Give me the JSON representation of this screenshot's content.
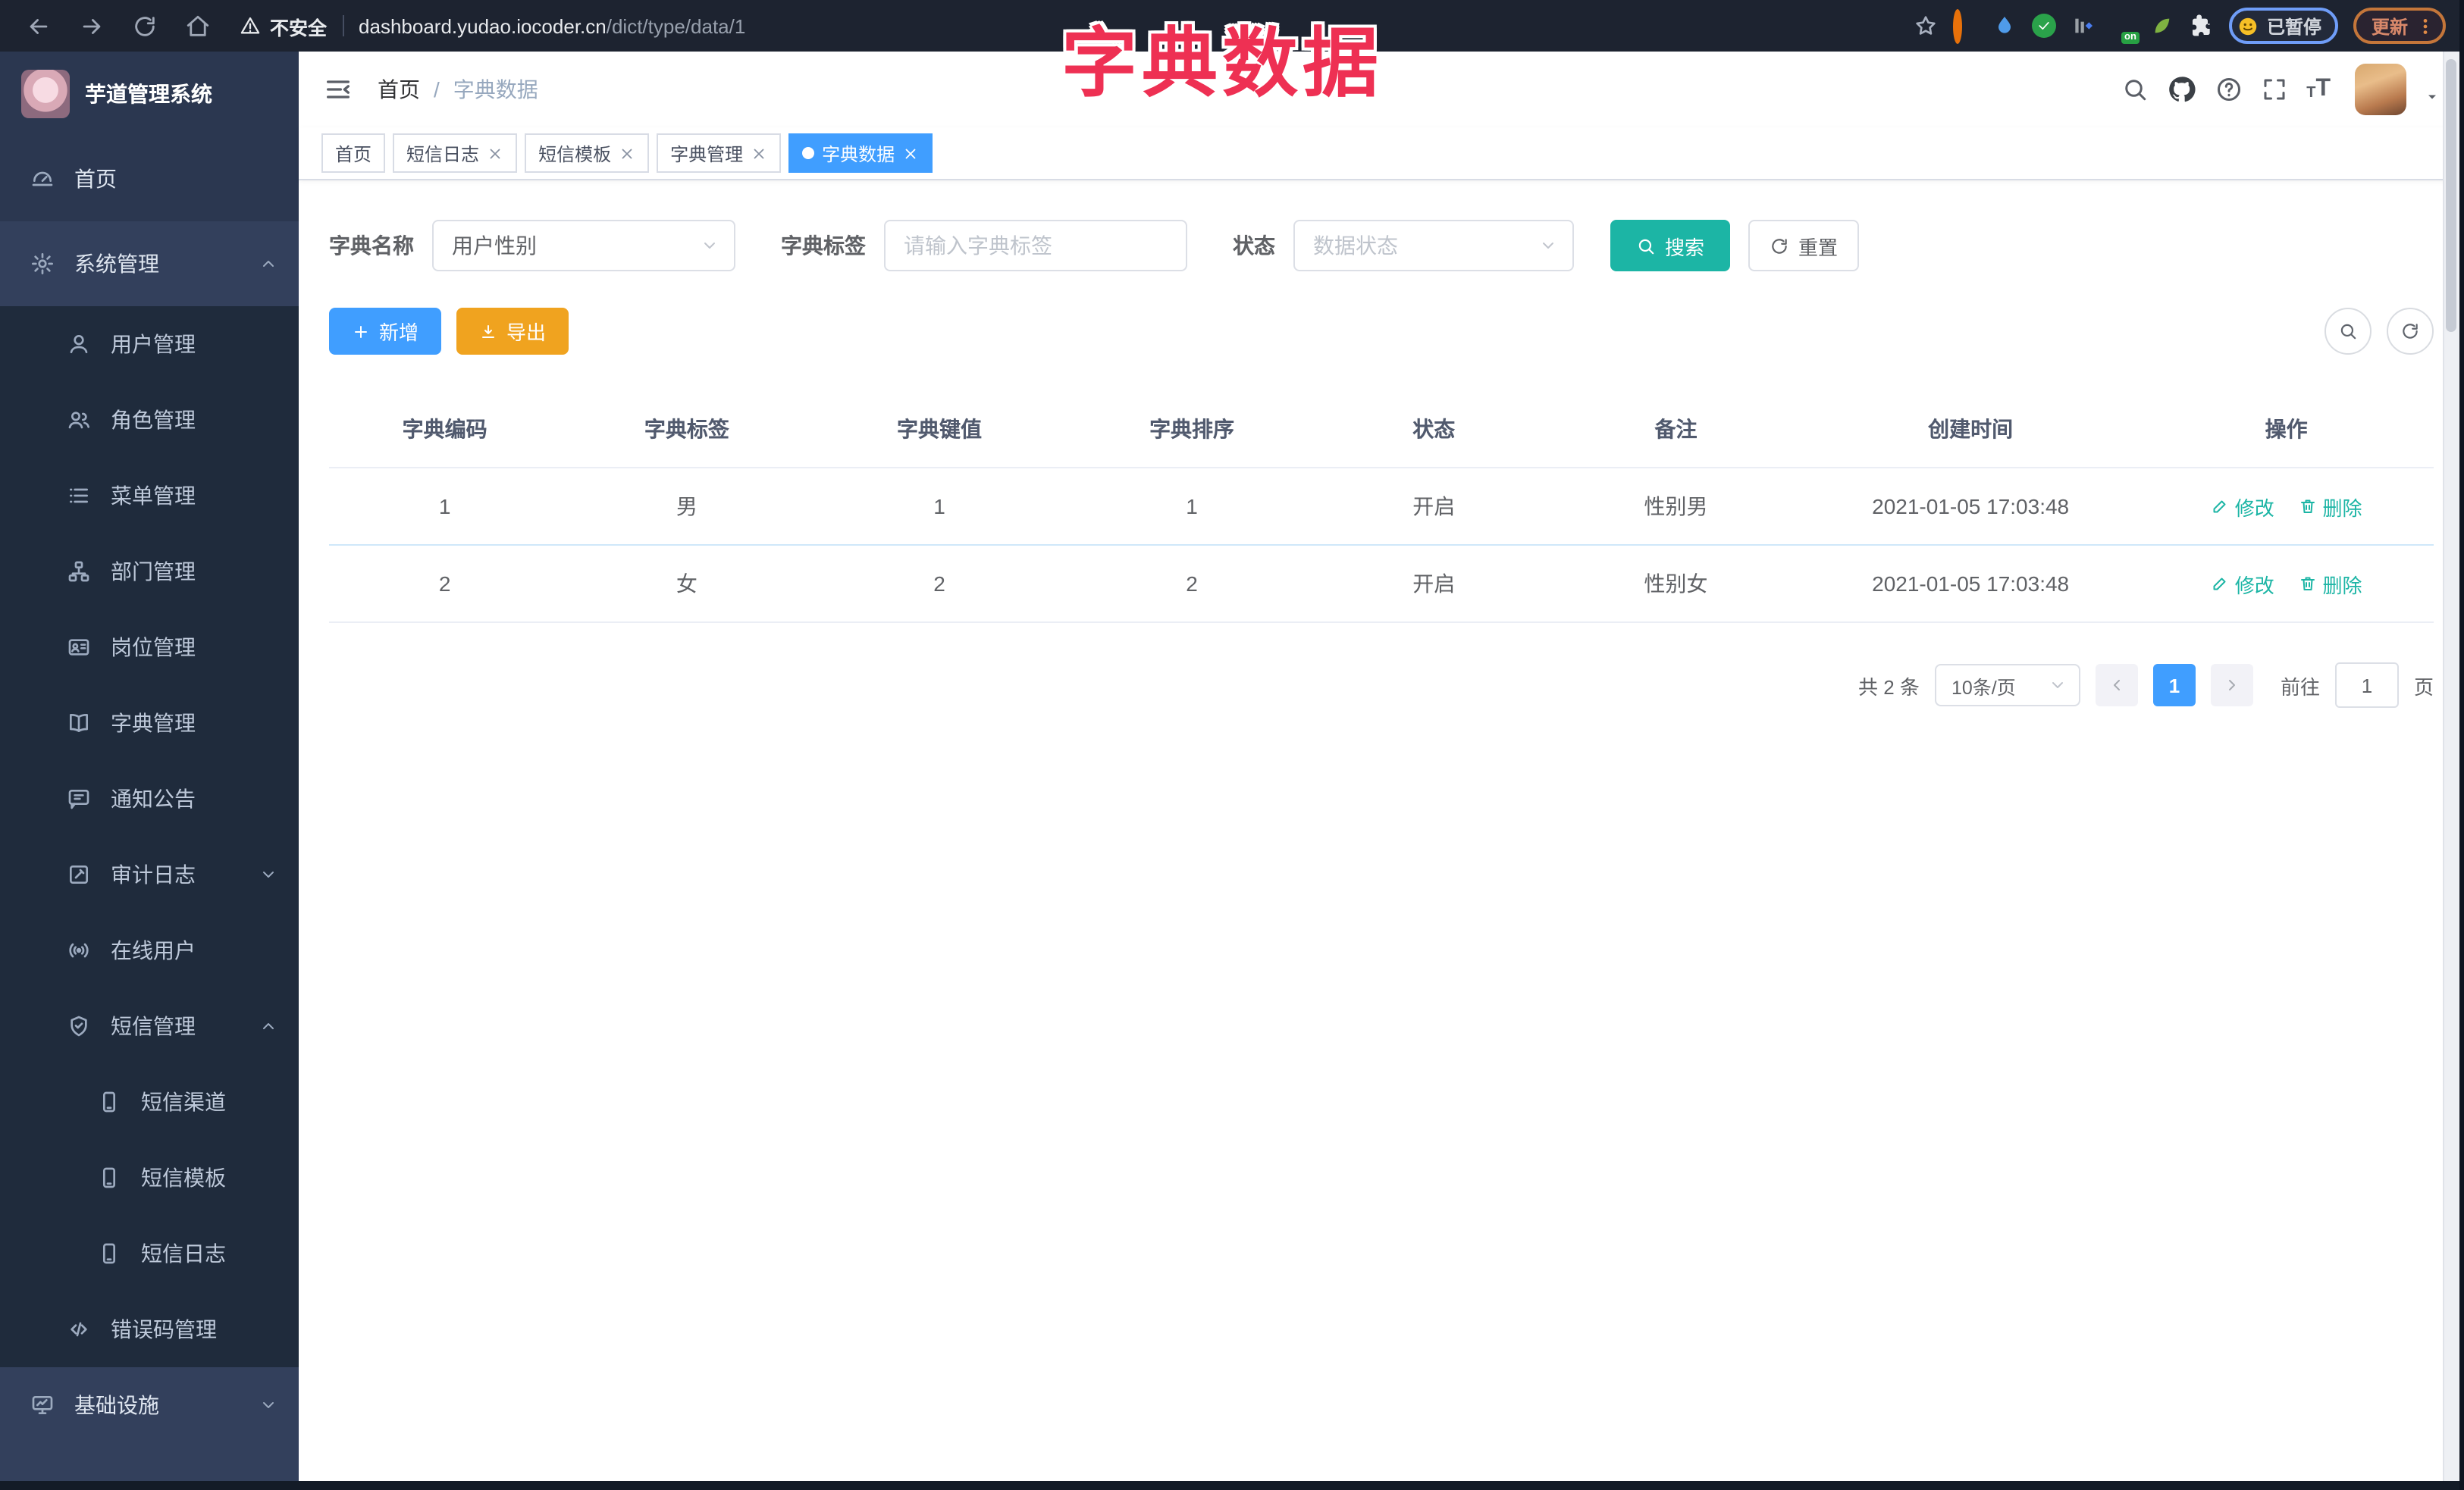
{
  "browser": {
    "security_label": "不安全",
    "url_host": "dashboard.yudao.iocoder.cn",
    "url_path": "/dict/type/data/1",
    "ext_on_badge": "on",
    "paused_label": "已暂停",
    "update_label": "更新"
  },
  "annotation": {
    "text": "字典数据",
    "color": "#ee3053"
  },
  "sidebar": {
    "logo_title": "芋道管理系统",
    "items": [
      {
        "label": "首页"
      },
      {
        "label": "系统管理"
      },
      {
        "label": "用户管理"
      },
      {
        "label": "角色管理"
      },
      {
        "label": "菜单管理"
      },
      {
        "label": "部门管理"
      },
      {
        "label": "岗位管理"
      },
      {
        "label": "字典管理"
      },
      {
        "label": "通知公告"
      },
      {
        "label": "审计日志"
      },
      {
        "label": "在线用户"
      },
      {
        "label": "短信管理"
      },
      {
        "label": "短信渠道"
      },
      {
        "label": "短信模板"
      },
      {
        "label": "短信日志"
      },
      {
        "label": "错误码管理"
      },
      {
        "label": "基础设施"
      }
    ]
  },
  "navbar": {
    "breadcrumb_home": "首页",
    "breadcrumb_sep": "/",
    "breadcrumb_current": "字典数据"
  },
  "tabs": {
    "items": [
      {
        "label": "首页"
      },
      {
        "label": "短信日志"
      },
      {
        "label": "短信模板"
      },
      {
        "label": "字典管理"
      },
      {
        "label": "字典数据"
      }
    ]
  },
  "filters": {
    "name_label": "字典名称",
    "name_value": "用户性别",
    "tag_label": "字典标签",
    "tag_placeholder": "请输入字典标签",
    "status_label": "状态",
    "status_placeholder": "数据状态",
    "search_label": "搜索",
    "reset_label": "重置"
  },
  "actions": {
    "add_label": "新增",
    "export_label": "导出"
  },
  "table": {
    "headers": [
      "字典编码",
      "字典标签",
      "字典键值",
      "字典排序",
      "状态",
      "备注",
      "创建时间",
      "操作"
    ],
    "rows": [
      {
        "code": "1",
        "label": "男",
        "value": "1",
        "sort": "1",
        "status": "开启",
        "remark": "性别男",
        "created": "2021-01-05 17:03:48"
      },
      {
        "code": "2",
        "label": "女",
        "value": "2",
        "sort": "2",
        "status": "开启",
        "remark": "性别女",
        "created": "2021-01-05 17:03:48"
      }
    ],
    "edit_label": "修改",
    "delete_label": "删除"
  },
  "pagination": {
    "total": "共 2 条",
    "page_size": "10条/页",
    "current_page": "1",
    "goto_label": "前往",
    "goto_value": "1",
    "page_unit": "页"
  },
  "colors": {
    "accent_blue": "#409EFF",
    "theme_teal": "#1CB5A5",
    "warning_orange": "#F0A31F",
    "annotation_red": "#EE3053",
    "sidebar_bg": "#2B3750",
    "submenu_bg": "#1F2B3C"
  }
}
